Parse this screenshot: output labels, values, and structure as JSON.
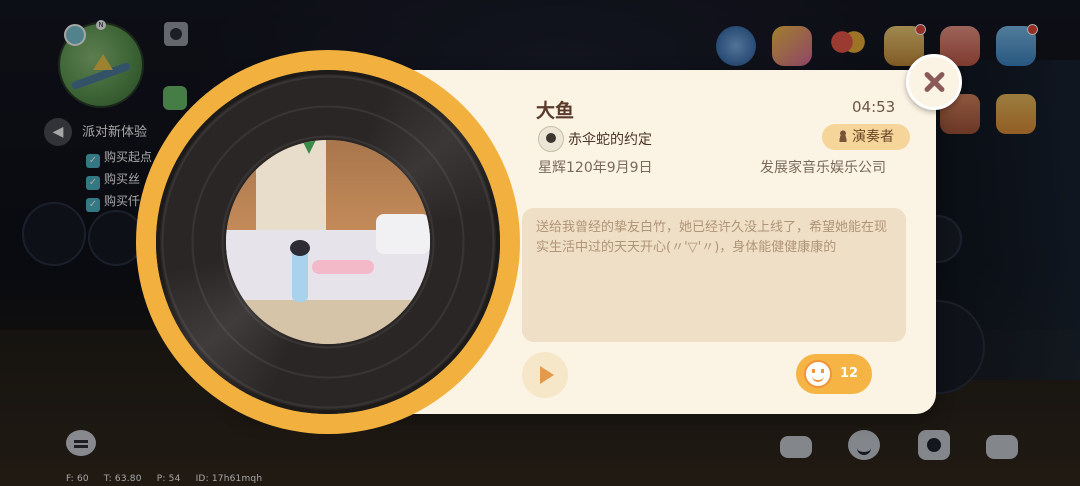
{
  "hud": {
    "quest_panel": {
      "title": "派对新体验",
      "items": [
        "购买起点",
        "购买丝",
        "购买仟"
      ]
    },
    "debug": {
      "fps": "F: 60",
      "time": "T: 63.80",
      "ping": "P: 54",
      "id": "ID: 17h61mqh"
    },
    "top_icons": [
      "planet-icon",
      "party-popper-icon",
      "balloons-icon",
      "gift-shop-icon",
      "basket-icon",
      "tablet-icon"
    ],
    "bottom_icons": [
      "car-icon",
      "emote-icon",
      "camera-icon",
      "toolbox-icon"
    ]
  },
  "record_card": {
    "song_title": "大鱼",
    "duration": "04:53",
    "player_name": "赤伞蛇的约定",
    "role_badge": "演奏者",
    "date": "星辉120年9月9日",
    "company": "发展家音乐娱乐公司",
    "message": "送给我曾经的挚友白竹，她已经许久没上线了，希望她能在现实生活中过的天天开心(〃'▽'〃)，身体能健健康康的",
    "like_count": "12"
  },
  "colors": {
    "card_bg": "#fbf3e3",
    "accent_orange": "#f2b13e",
    "title_brown": "#5a3a2a",
    "close_icon": "#8a5a58"
  }
}
